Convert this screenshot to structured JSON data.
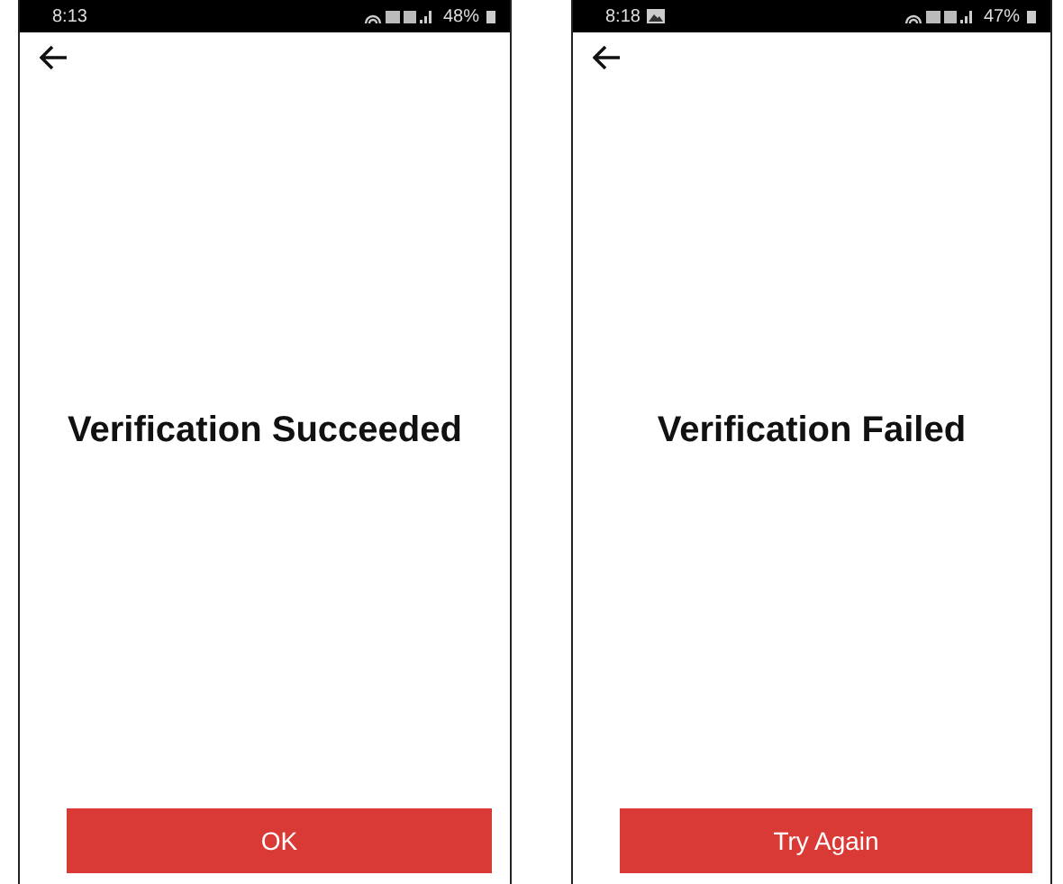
{
  "screens": [
    {
      "status_bar": {
        "time": "8:13",
        "battery": "48%",
        "picture_notification": false
      },
      "message": "Verification Succeeded",
      "button": "OK"
    },
    {
      "status_bar": {
        "time": "8:18",
        "battery": "47%",
        "picture_notification": true
      },
      "message": "Verification Failed",
      "button": "Try Again"
    }
  ]
}
